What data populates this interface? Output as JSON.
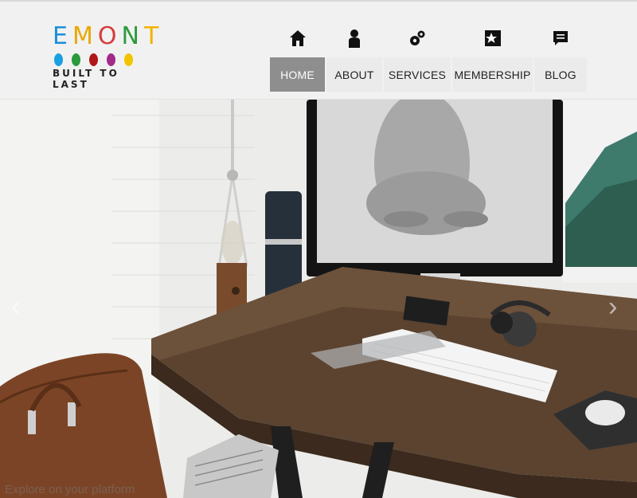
{
  "brand": {
    "letters": [
      {
        "ch": "E",
        "color": "#1a8fd8"
      },
      {
        "ch": "M",
        "color": "#e8a800"
      },
      {
        "ch": "O",
        "color": "#d83b3b"
      },
      {
        "ch": "N",
        "color": "#2b9b3b"
      },
      {
        "ch": "T",
        "color": "#f2b200"
      }
    ],
    "dot_colors": [
      "#1a9fe0",
      "#2a9a3a",
      "#b01818",
      "#a12a8a",
      "#f2c400"
    ],
    "tagline": "BUILT TO LAST"
  },
  "nav": {
    "items": [
      {
        "label": "HOME",
        "icon": "home-icon",
        "active": true
      },
      {
        "label": "ABOUT",
        "icon": "user-icon",
        "active": false
      },
      {
        "label": "SERVICES",
        "icon": "gears-icon",
        "active": false
      },
      {
        "label": "MEMBERSHIP",
        "icon": "star-card-icon",
        "active": false
      },
      {
        "label": "BLOG",
        "icon": "chat-icon",
        "active": false
      }
    ],
    "active_color": "#8e8e8e"
  },
  "hero": {
    "caption": "Explore on your platform",
    "prev_icon": "chevron-left-icon",
    "next_icon": "chevron-right-icon"
  }
}
